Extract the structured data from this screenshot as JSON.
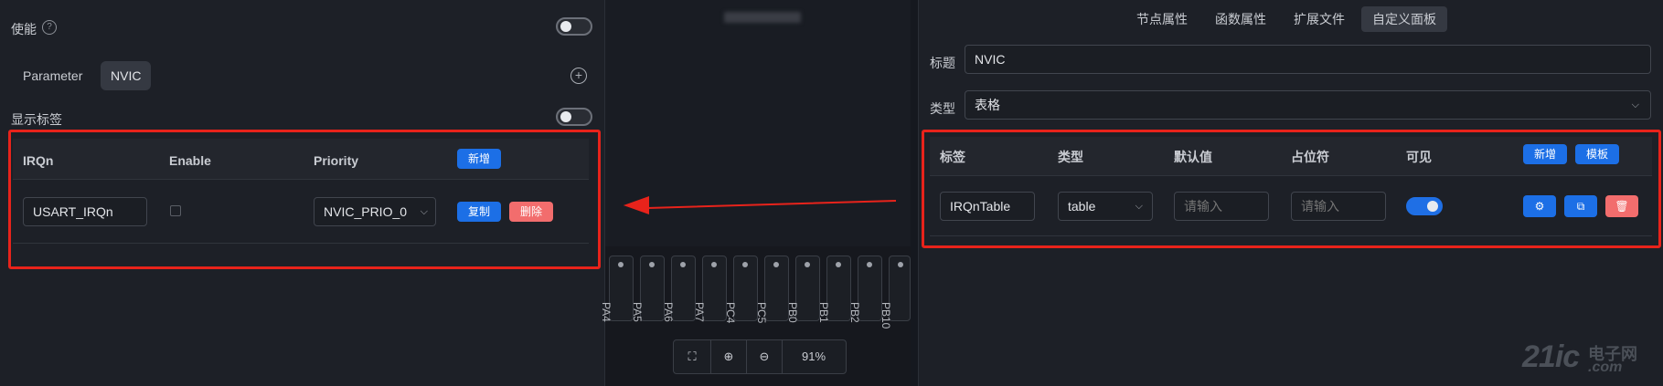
{
  "left": {
    "enable_label": "使能",
    "param_label": "Parameter",
    "param_value": "NVIC",
    "show_label_text": "显示标签",
    "table": {
      "headers": [
        "IRQn",
        "Enable",
        "Priority"
      ],
      "add_label": "新增",
      "row": {
        "irqn": "USART_IRQn",
        "priority": "NVIC_PRIO_0",
        "copy_label": "复制",
        "delete_label": "删除"
      }
    }
  },
  "middle": {
    "pins": [
      "PA4",
      "PA5",
      "PA6",
      "PA7",
      "PC4",
      "PC5",
      "PB0",
      "PB1",
      "PB2",
      "PB10"
    ],
    "zoom_level": "91%"
  },
  "right": {
    "tabs": [
      "节点属性",
      "函数属性",
      "扩展文件",
      "自定义面板"
    ],
    "active_tab": 3,
    "title_label": "标题",
    "title_value": "NVIC",
    "type_label": "类型",
    "type_value": "表格",
    "table": {
      "headers": [
        "标签",
        "类型",
        "默认值",
        "占位符",
        "可见"
      ],
      "add_label": "新增",
      "template_label": "模板",
      "row": {
        "label_value": "IRQnTable",
        "type_value": "table",
        "default_placeholder": "请输入",
        "placeholder_placeholder": "请输入",
        "visible": true
      }
    }
  },
  "watermark": {
    "brand_main": "21ic",
    "brand_cn": "电子网",
    "brand_url": ".com"
  },
  "colors": {
    "accent_blue": "#1c6fe6",
    "danger_red": "#f26d6d",
    "highlight_red": "#e8231b"
  }
}
